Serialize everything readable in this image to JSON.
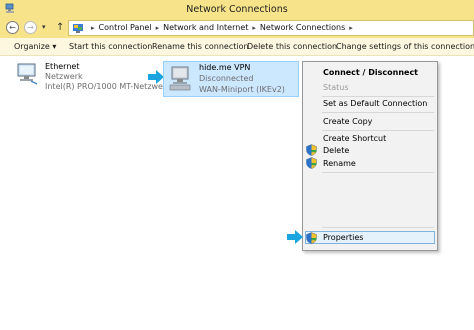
{
  "window": {
    "title": "Network Connections",
    "icon": "network-connections-icon"
  },
  "address": {
    "back_icon": "back-arrow-icon",
    "forward_icon": "forward-arrow-icon",
    "up_icon": "up-arrow-icon",
    "crumbs": [
      "Control Panel",
      "Network and Internet",
      "Network Connections"
    ]
  },
  "toolbar": {
    "organize": "Organize",
    "start": "Start this connection",
    "rename": "Rename this connection",
    "delete": "Delete this connection",
    "settings": "Change settings of this connection"
  },
  "connections": [
    {
      "name": "Ethernet",
      "status": "Netzwerk",
      "device": "Intel(R) PRO/1000 MT-Netzwerkv..."
    },
    {
      "name": "hide.me VPN",
      "status": "Disconnected",
      "device": "WAN-Miniport (IKEv2)"
    }
  ],
  "context_menu": {
    "connect": "Connect / Disconnect",
    "status": "Status",
    "default": "Set as Default Connection",
    "copy": "Create Copy",
    "shortcut": "Create Shortcut",
    "delete": "Delete",
    "rename": "Rename",
    "properties": "Properties"
  },
  "colors": {
    "titlebar": "#f7e38a",
    "selection": "#cce8ff",
    "arrow": "#1aa5e0"
  }
}
